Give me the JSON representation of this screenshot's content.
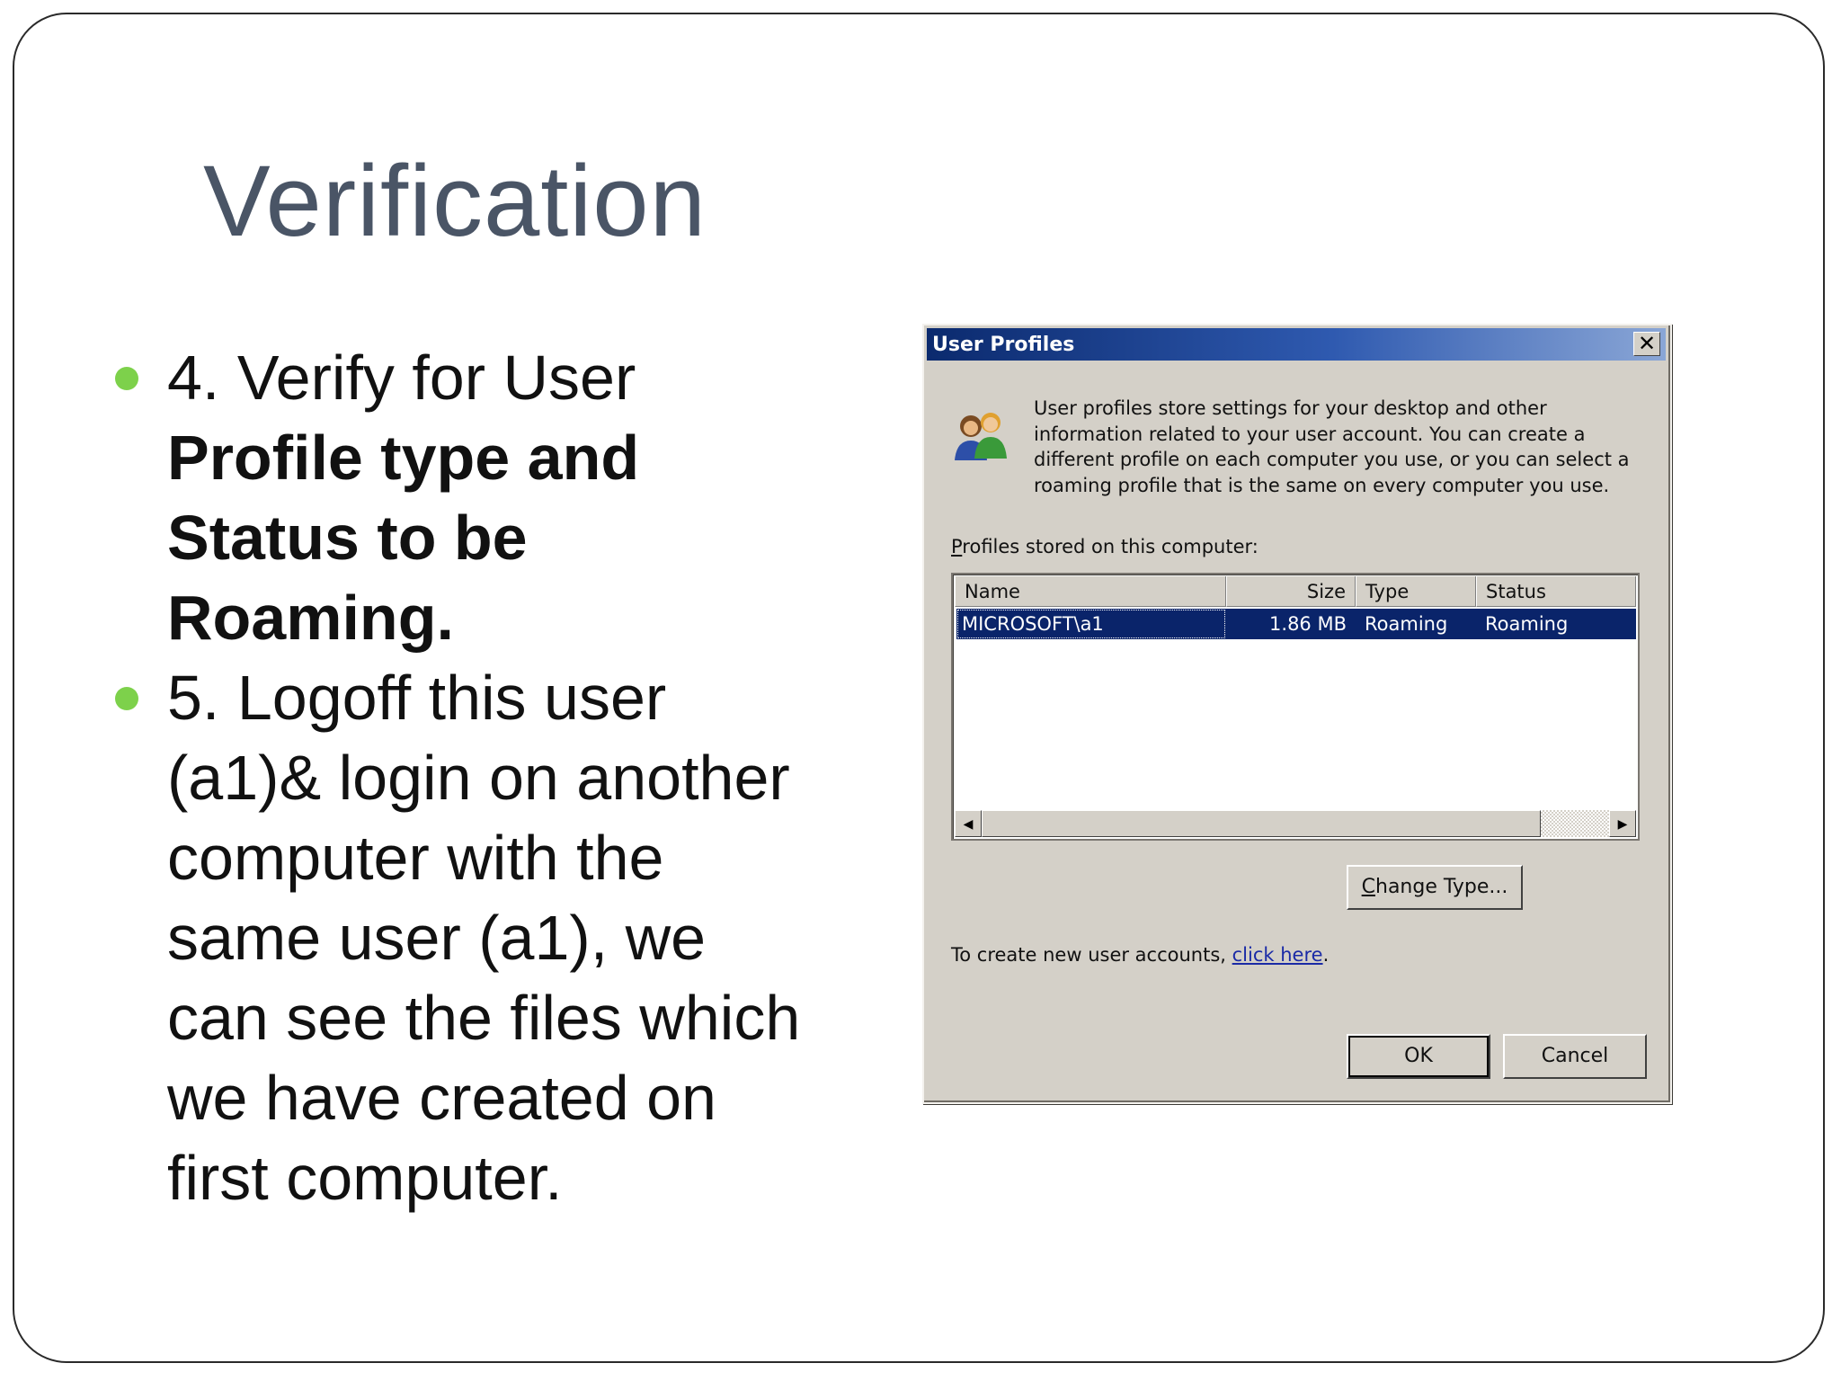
{
  "slide": {
    "title": "Verification",
    "bullets": [
      {
        "plain": "4. Verify for User ",
        "bold": "Profile type and Status to be Roaming.",
        "after": ""
      },
      {
        "plain": "5. Logoff this user (a1)& login on another computer with the same user (a1), we can see the files which we have created on first computer.",
        "bold": "",
        "after": ""
      }
    ],
    "accent_color": "#7dd14b"
  },
  "dialog": {
    "title": "User Profiles",
    "close_label": "✕",
    "description": "User profiles store settings for your desktop and other information related to your user account. You can create a different profile on each computer you use, or you can select a roaming profile that is the same on every computer you use.",
    "profiles_label_accesskey": "P",
    "profiles_label_rest": "rofiles stored on this computer:",
    "columns": [
      "Name",
      "Size",
      "Type",
      "Status"
    ],
    "rows": [
      {
        "name": "MICROSOFT\\a1",
        "size": "1.86 MB",
        "type": "Roaming",
        "status": "Roaming"
      }
    ],
    "change_type_accesskey": "C",
    "change_type_rest": "hange Type...",
    "create_text": "To create new user accounts, ",
    "create_link": "click here",
    "create_after": ".",
    "ok_label": "OK",
    "cancel_label": "Cancel"
  }
}
